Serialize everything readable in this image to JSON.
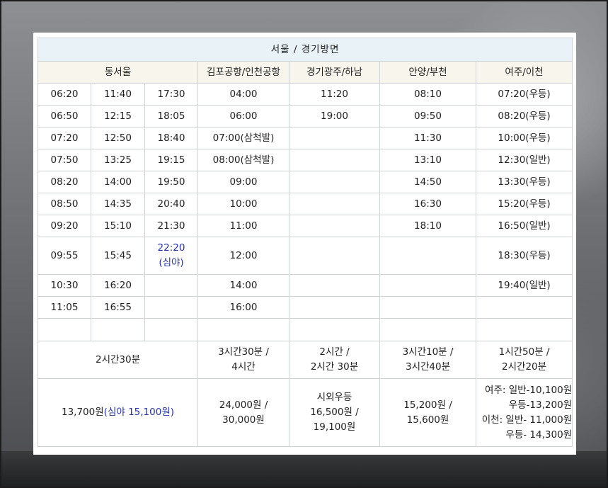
{
  "title": "서울 / 경기방면",
  "headers": {
    "east_seoul": "동서울",
    "gimpo": "김포공항/인천공항",
    "gwangju": "경기광주/하남",
    "anyang": "안양/부천",
    "yeoju": "여주/이천"
  },
  "rows": [
    [
      "06:20",
      "11:40",
      "17:30",
      "04:00",
      "11:20",
      "08:10",
      "07:20(우등)"
    ],
    [
      "06:50",
      "12:15",
      "18:05",
      "06:00",
      "19:00",
      "09:50",
      "08:20(우등)"
    ],
    [
      "07:20",
      "12:50",
      "18:40",
      "07:00(삼척발)",
      "",
      "11:30",
      "10:00(우등)"
    ],
    [
      "07:50",
      "13:25",
      "19:15",
      "08:00(삼척발)",
      "",
      "13:10",
      "12:30(일반)"
    ],
    [
      "08:20",
      "14:00",
      "19:50",
      "09:00",
      "",
      "14:50",
      "13:30(우등)"
    ],
    [
      "08:50",
      "14:35",
      "20:40",
      "10:00",
      "",
      "16:30",
      "15:20(우등)"
    ],
    [
      "09:20",
      "15:10",
      "21:30",
      "11:00",
      "",
      "18:10",
      "16:50(일반)"
    ],
    [
      "09:55",
      "15:45",
      "",
      "12:00",
      "",
      "",
      "18:30(우등)"
    ],
    [
      "10:30",
      "16:20",
      "",
      "14:00",
      "",
      "",
      "19:40(일반)"
    ],
    [
      "11:05",
      "16:55",
      "",
      "16:00",
      "",
      "",
      ""
    ]
  ],
  "late_night": {
    "time": "22:20",
    "note": "(심야)"
  },
  "duration": {
    "east_seoul": "2시간30분",
    "gimpo": [
      "3시간30분 /",
      "4시간"
    ],
    "gwangju": [
      "2시간 /",
      "2시간 30분"
    ],
    "anyang": [
      "3시간10분 /",
      "3시간40분"
    ],
    "yeoju": [
      "1시간50분 /",
      "2시간20분"
    ]
  },
  "fare": {
    "east_seoul": "13,700원",
    "east_seoul_night": "(심야 15,100원)",
    "gimpo": [
      "24,000원 /",
      "30,000원"
    ],
    "gwangju": [
      "시외우등",
      "16,500원 /",
      "19,100원"
    ],
    "anyang": [
      "15,200원 /",
      "15,600원"
    ],
    "yeoju": [
      "여주: 일반-10,100원",
      "우등-13,200원",
      "이천: 일반- 11,000원",
      "우등- 14,300원"
    ]
  },
  "colors": {
    "title_bg": "#e8f2f7",
    "header_bg": "#f8f5ec",
    "accent_blue": "#2233aa"
  }
}
